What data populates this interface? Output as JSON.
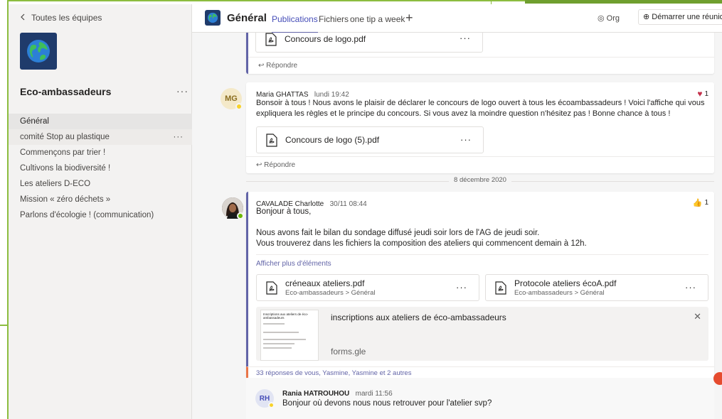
{
  "sidebar": {
    "back_label": "Toutes les équipes",
    "team_name": "Eco-ambassadeurs",
    "channels": [
      {
        "label": "Général"
      },
      {
        "label": "comité Stop au plastique"
      },
      {
        "label": "Commençons par trier !"
      },
      {
        "label": "Cultivons la biodiversité !"
      },
      {
        "label": "Les ateliers D-ECO"
      },
      {
        "label": "Mission « zéro déchets »"
      },
      {
        "label": "Parlons d'écologie ! (communication)"
      }
    ]
  },
  "header": {
    "channel_title": "Général",
    "tabs": [
      {
        "label": "Publications"
      },
      {
        "label": "Fichiers"
      },
      {
        "label": "one tip a week"
      }
    ],
    "org_label": "Org",
    "meet_label": "Démarrer une réunion"
  },
  "feed": {
    "reply_label": "Répondre",
    "post0": {
      "file_name": "Concours de logo.pdf"
    },
    "post1": {
      "initials": "MG",
      "author": "Maria GHATTAS",
      "time": "lundi 19:42",
      "text": "Bonsoir à tous ! Nous avons le plaisir de déclarer le concours de logo ouvert à tous les écoambassadeurs ! Voici l'affiche qui vous expliquera les règles et le principe du concours. Si vous avez la moindre question n'hésitez pas ! Bonne chance à tous !",
      "file_name": "Concours de logo (5).pdf",
      "reaction_count": "1"
    },
    "date_separator": "8 décembre 2020",
    "post2": {
      "author": "CAVALADE Charlotte",
      "time": "30/11 08:44",
      "line1": "Bonjour à tous,",
      "line2": "Nous avons fait le bilan du sondage diffusé jeudi soir lors de l'AG de jeudi soir.",
      "line3": "Vous trouverez dans les fichiers la composition des ateliers qui commencent demain à 12h.",
      "show_more": "Afficher plus d'éléments",
      "reaction_count": "1",
      "file1": {
        "name": "créneaux ateliers.pdf",
        "path": "Eco-ambassadeurs > Général"
      },
      "file2": {
        "name": "Protocole ateliers écoA.pdf",
        "path": "Eco-ambassadeurs > Général"
      },
      "link_title": "inscriptions aux ateliers de éco-ambassadeurs",
      "link_domain": "forms.gle",
      "preview_title": "Inscriptions aux ateliers de éco-ambassadeurs",
      "replies_summary": "33 réponses de vous, Yasmine, Yasmine et 2 autres"
    },
    "reply1": {
      "initials": "RH",
      "author": "Rania HATROUHOU",
      "time": "mardi 11:56",
      "text": "Bonjour où devons nous nous retrouver pour l'atelier svp?"
    }
  },
  "colors": {
    "accent": "#6264a7",
    "frame_green": "#8cbd3f",
    "heart": "#c4314b",
    "away": "#f8d22a",
    "online": "#6bb700"
  }
}
